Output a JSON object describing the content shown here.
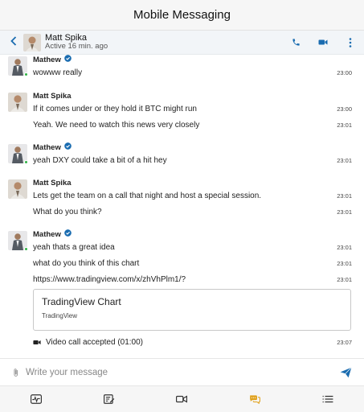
{
  "app": {
    "title": "Mobile Messaging"
  },
  "header": {
    "contact_name": "Matt Spika",
    "status": "Active 16 min. ago",
    "back_icon": "chevron-left-icon",
    "actions": [
      "phone-icon",
      "video-camera-icon",
      "more-vertical-icon"
    ]
  },
  "messages": [
    {
      "sender": "Mathew",
      "verified": true,
      "online": true,
      "items": [
        {
          "text": "wowww really",
          "time": "23:00"
        }
      ]
    },
    {
      "sender": "Matt Spika",
      "verified": false,
      "online": false,
      "items": [
        {
          "text": "If it comes under or they hold it BTC might run",
          "time": "23:00"
        },
        {
          "text": "Yeah. We need to watch this news very closely",
          "time": "23:01"
        }
      ]
    },
    {
      "sender": "Mathew",
      "verified": true,
      "online": true,
      "items": [
        {
          "text": "yeah DXY could take a bit of a hit hey",
          "time": "23:01"
        }
      ]
    },
    {
      "sender": "Matt Spika",
      "verified": false,
      "online": false,
      "items": [
        {
          "text": "Lets get the team on a call that night and host a special session.",
          "time": "23:01"
        },
        {
          "text": "What do you think?",
          "time": "23:01"
        }
      ]
    },
    {
      "sender": "Mathew",
      "verified": true,
      "online": true,
      "items": [
        {
          "text": "yeah thats a great idea",
          "time": "23:01"
        },
        {
          "text": "what do you think of this chart",
          "time": "23:01"
        },
        {
          "text": "https://www.tradingview.com/x/zhVhPlm1/?",
          "time": "23:01"
        }
      ],
      "link_preview": {
        "title": "TradingView Chart",
        "site": "TradingView"
      },
      "call": {
        "text": "Video call accepted (01:00)",
        "time": "23:07",
        "icon": "video-camera-icon"
      }
    }
  ],
  "composer": {
    "placeholder": "Write your message",
    "value": "",
    "attach_icon": "paperclip-icon",
    "send_icon": "send-icon"
  },
  "bottom_nav": [
    "activity-icon",
    "edit-note-icon",
    "video-camera-icon",
    "chat-bubbles-icon",
    "menu-list-icon"
  ],
  "colors": {
    "accent": "#1a6cb0",
    "online": "#2fb344",
    "active_nav": "#e0a11b",
    "verified": "#1a6cb0"
  }
}
